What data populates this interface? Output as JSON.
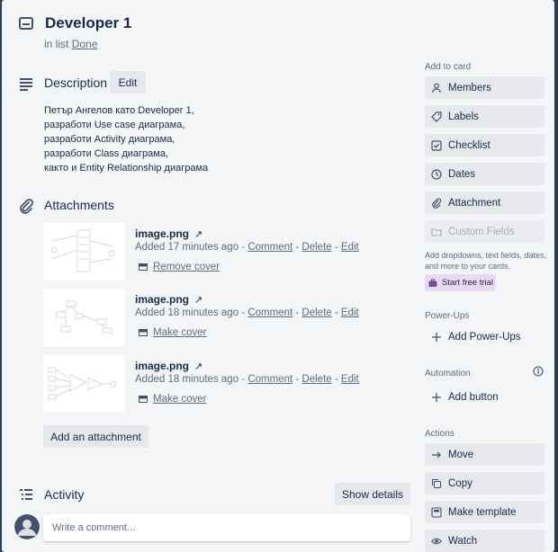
{
  "card": {
    "title": "Developer 1",
    "in_list_prefix": "in list",
    "list_name": "Done"
  },
  "description": {
    "heading": "Description",
    "edit_label": "Edit",
    "lines": [
      "Петър Ангелов като Developer 1,",
      "разработи Use case диаграма,",
      "разработи Activity диаграма,",
      "разработи Class диаграма,",
      "както и Entity Relationship диаграма"
    ]
  },
  "attachments": {
    "heading": "Attachments",
    "items": [
      {
        "name": "image.png",
        "ext_icon": "↗",
        "added": "Added 17 minutes ago -",
        "comment": "Comment",
        "delete": "Delete",
        "edit": "Edit",
        "cover": "Remove cover"
      },
      {
        "name": "image.png",
        "ext_icon": "↗",
        "added": "Added 18 minutes ago -",
        "comment": "Comment",
        "delete": "Delete",
        "edit": "Edit",
        "cover": "Make cover"
      },
      {
        "name": "image.png",
        "ext_icon": "↗",
        "added": "Added 18 minutes ago -",
        "comment": "Comment",
        "delete": "Delete",
        "edit": "Edit",
        "cover": "Make cover"
      }
    ],
    "separator": "-",
    "add_label": "Add an attachment"
  },
  "activity": {
    "heading": "Activity",
    "show_details": "Show details",
    "comment_placeholder": "Write a comment..."
  },
  "sidebar": {
    "add_to_card": "Add to card",
    "add_items": [
      {
        "label": "Members",
        "icon": "person-icon"
      },
      {
        "label": "Labels",
        "icon": "tag-icon"
      },
      {
        "label": "Checklist",
        "icon": "checklist-icon"
      },
      {
        "label": "Dates",
        "icon": "clock-icon"
      },
      {
        "label": "Attachment",
        "icon": "paperclip-icon"
      },
      {
        "label": "Custom Fields",
        "icon": "folder-icon"
      }
    ],
    "custom_fields_note": "Add dropdowns, text fields, dates, and more to your cards.",
    "trial_label": "Start free trial",
    "powerups_heading": "Power-Ups",
    "add_powerups": "Add Power-Ups",
    "automation_heading": "Automation",
    "add_button": "Add button",
    "actions_heading": "Actions",
    "actions": [
      {
        "label": "Move",
        "icon": "arrow-right-icon"
      },
      {
        "label": "Copy",
        "icon": "copy-icon"
      },
      {
        "label": "Make template",
        "icon": "template-icon"
      },
      {
        "label": "Watch",
        "icon": "eye-icon"
      }
    ]
  },
  "colors": {
    "panel": "#f4f5f7",
    "button": "#e6e8ec",
    "text": "#172b4d",
    "muted": "#5e6c84",
    "trial": "#ead8f5"
  }
}
